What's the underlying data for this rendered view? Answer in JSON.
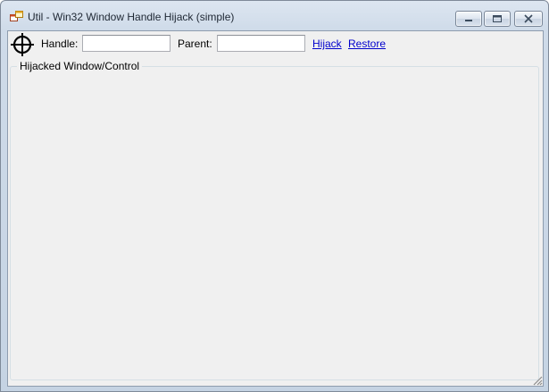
{
  "window": {
    "title": "Util - Win32 Window Handle Hijack (simple)",
    "icon": "application-window-icon",
    "controls": [
      "minimize",
      "maximize",
      "close"
    ]
  },
  "toolbar": {
    "crosshair_icon": "crosshair-finder-icon",
    "handle_label": "Handle:",
    "handle_value": "",
    "parent_label": "Parent:",
    "parent_value": "",
    "hijack_link": "Hijack",
    "restore_link": "Restore"
  },
  "group": {
    "title": "Hijacked Window/Control"
  },
  "colors": {
    "client_bg": "#f0f0f0",
    "frame": "#cfdbe9",
    "link": "#0000cc"
  }
}
